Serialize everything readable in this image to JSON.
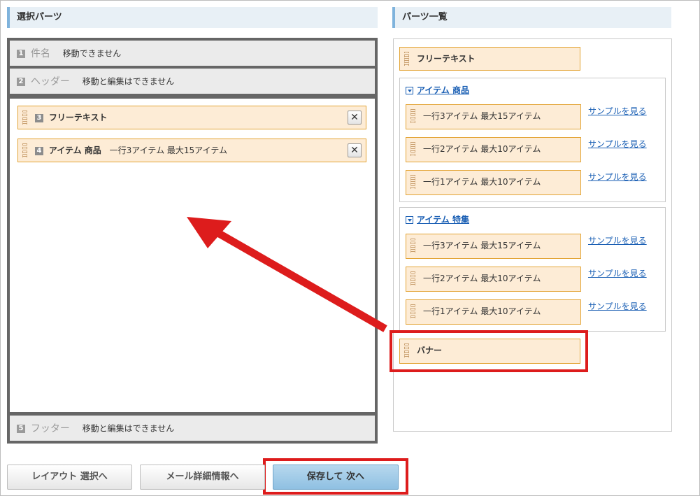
{
  "left": {
    "title": "選択パーツ",
    "rows": [
      {
        "num": "1",
        "title": "件名",
        "note": "移動できません"
      },
      {
        "num": "2",
        "title": "ヘッダー",
        "note": "移動と編集はできません"
      }
    ],
    "footer": {
      "num": "5",
      "title": "フッター",
      "note": "移動と編集はできません"
    },
    "parts": [
      {
        "num": "3",
        "title": "フリーテキスト",
        "detail": ""
      },
      {
        "num": "4",
        "title": "アイテム 商品",
        "detail": "一行3アイテム 最大15アイテム"
      }
    ],
    "close_symbol": "✕"
  },
  "right": {
    "title": "パーツ一覧",
    "free_text": "フリーテキスト",
    "groups": [
      {
        "title": "アイテム 商品",
        "items": [
          {
            "label": "一行3アイテム 最大15アイテム",
            "link": "サンプルを見る"
          },
          {
            "label": "一行2アイテム 最大10アイテム",
            "link": "サンプルを見る"
          },
          {
            "label": "一行1アイテム 最大10アイテム",
            "link": "サンプルを見る"
          }
        ]
      },
      {
        "title": "アイテム 特集",
        "items": [
          {
            "label": "一行3アイテム 最大15アイテム",
            "link": "サンプルを見る"
          },
          {
            "label": "一行2アイテム 最大10アイテム",
            "link": "サンプルを見る"
          },
          {
            "label": "一行1アイテム 最大10アイテム",
            "link": "サンプルを見る"
          }
        ]
      }
    ],
    "banner": "バナー"
  },
  "buttons": {
    "layout": "レイアウト 選択へ",
    "mail": "メール詳細情報へ",
    "save": "保存して 次へ"
  },
  "colors": {
    "accent_red": "#dd1c1c",
    "part_fill": "#fdecd6",
    "part_border": "#e3a435",
    "link_blue": "#1a5fb4"
  }
}
